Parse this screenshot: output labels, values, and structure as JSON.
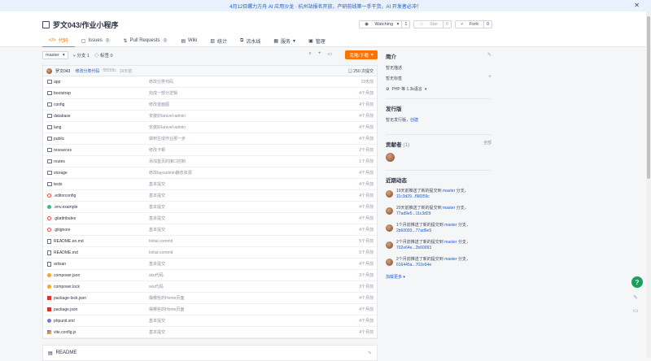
{
  "banner": {
    "text": "4月12日螺力方舟 AI 应用沙龙 · 杭州站报名开放，产研前线第一手干货，AI 开发者必冲！",
    "close": "✕"
  },
  "repo": {
    "title": "罗文043/作业小程序",
    "watching": {
      "label": "Watching",
      "count": "1"
    },
    "star": {
      "label": "Star",
      "count": "0"
    },
    "fork": {
      "label": "Fork",
      "count": "0"
    }
  },
  "tabs": [
    {
      "label": "代码",
      "badge": ""
    },
    {
      "label": "Issues",
      "badge": "0"
    },
    {
      "label": "Pull Requests",
      "badge": "0"
    },
    {
      "label": "Wiki",
      "badge": ""
    },
    {
      "label": "统计",
      "badge": ""
    },
    {
      "label": "流水线",
      "badge": ""
    },
    {
      "label": "服务",
      "badge": ""
    },
    {
      "label": "管理",
      "badge": ""
    }
  ],
  "toolbar": {
    "branch": "master",
    "branches": "分支 1",
    "tags": "标签 0",
    "clone": "克隆/下载"
  },
  "commit": {
    "author": "罗文043",
    "message": "修改分类代码",
    "sha": "f9f359c",
    "ago": "19天前",
    "count": "250 次提交"
  },
  "files": [
    {
      "name": "app",
      "type": "folder",
      "msg": "修改分类代码",
      "age": "19天前"
    },
    {
      "name": "bootstrap",
      "type": "folder",
      "msg": "完成一部分逻辑",
      "age": "4个月前"
    },
    {
      "name": "config",
      "type": "folder",
      "msg": "修改首面图",
      "age": "4个月前"
    },
    {
      "name": "database",
      "type": "folder",
      "msg": "安装好laravel-admin",
      "age": "4个月前"
    },
    {
      "name": "lang",
      "type": "folder",
      "msg": "安装好laravel-admin",
      "age": "4个月前"
    },
    {
      "name": "public",
      "type": "folder",
      "msg": "做到生成作业那一步",
      "age": "4个月前"
    },
    {
      "name": "resources",
      "type": "folder",
      "msg": "修改卡顿",
      "age": "2个月前"
    },
    {
      "name": "routes",
      "type": "folder",
      "msg": "添加首页的接口控制",
      "age": "1个月前"
    },
    {
      "name": "storage",
      "type": "folder",
      "msg": "修改layoadmin静态资源",
      "age": "4个月前"
    },
    {
      "name": "tests",
      "type": "folder",
      "msg": "基本提交",
      "age": "4个月前"
    },
    {
      "name": ".editorconfig",
      "type": "gear",
      "msg": "基本提交",
      "age": "4个月前"
    },
    {
      "name": ".env.example",
      "type": "env",
      "msg": "基本提交",
      "age": "4个月前"
    },
    {
      "name": ".gitattributes",
      "type": "gear",
      "msg": "基本提交",
      "age": "4个月前"
    },
    {
      "name": ".gitignore",
      "type": "gear",
      "msg": "基本提交",
      "age": "4个月前"
    },
    {
      "name": "README.en.md",
      "type": "file",
      "msg": "Initial commit",
      "age": "5个月前"
    },
    {
      "name": "README.md",
      "type": "file",
      "msg": "Initial commit",
      "age": "5个月前"
    },
    {
      "name": "artisan",
      "type": "file",
      "msg": "基本提交",
      "age": "4个月前"
    },
    {
      "name": "composer.json",
      "type": "json",
      "msg": "sku代码",
      "age": "3个月前"
    },
    {
      "name": "composer.lock",
      "type": "json",
      "msg": "sku代码",
      "age": "3个月前"
    },
    {
      "name": "package-lock.json",
      "type": "npm",
      "msg": "摆哪些的Home页面",
      "age": "4个月前"
    },
    {
      "name": "package.json",
      "type": "npm",
      "msg": "摆哪些的Home页面",
      "age": "4个月前"
    },
    {
      "name": "phpunit.xml",
      "type": "php",
      "msg": "基本提交",
      "age": "4个月前"
    },
    {
      "name": "vite.config.js",
      "type": "vite",
      "msg": "基本提交",
      "age": "4个月前"
    }
  ],
  "readme": {
    "label": "README"
  },
  "side": {
    "intro_title": "简介",
    "intro_desc": "暂无描述",
    "intro_tags": "暂无标签",
    "lang": "PHP 等 1.3k语言",
    "release_title": "发行版",
    "release_desc": "暂无发行版，",
    "release_create": "创建",
    "contrib_title": "贡献者",
    "contrib_count": "(1)",
    "contrib_all": "全部",
    "activity_title": "近期动态",
    "activities": [
      {
        "pre": "19天前推送了新的提交到",
        "branch": "master",
        "mid": "分支，",
        "range": "11c3d29...f98359c"
      },
      {
        "pre": "20天前推送了新的提交到",
        "branch": "master",
        "mid": "分支，",
        "range": "77ad9e5...11c3d29"
      },
      {
        "pre": "1个月前推送了新的提交到",
        "branch": "master",
        "mid": "分支，",
        "range": "2b60093...77ad9e5"
      },
      {
        "pre": "2个月前推送了新的提交到",
        "branch": "master",
        "mid": "分支，",
        "range": "702e64e...2b60093"
      },
      {
        "pre": "2个月前推送了新的提交到",
        "branch": "master",
        "mid": "分支，",
        "range": "616445a...702e64e"
      }
    ],
    "more": "加载更多"
  },
  "colors": {
    "accent": "#fe7300",
    "link": "#1e5cc8",
    "green": "#19a05a"
  }
}
